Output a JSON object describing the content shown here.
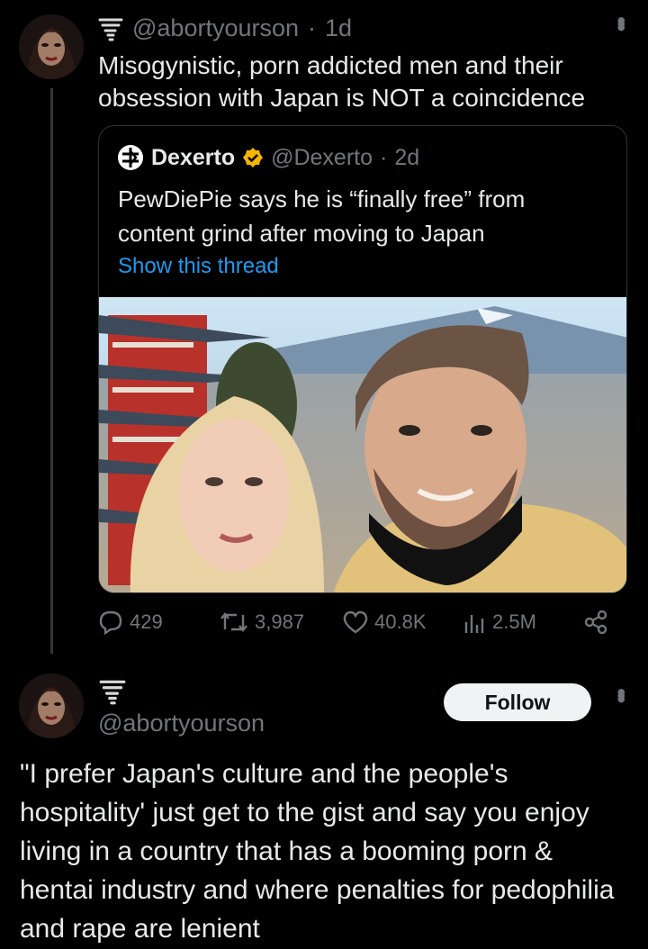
{
  "main_post": {
    "handle": "@abortyourson",
    "separator": "·",
    "time": "1d",
    "text": "Misogynistic, porn addicted men and their obsession with Japan is NOT a coincidence",
    "more_icon": "more-vertical-icon"
  },
  "quoted_post": {
    "name": "Dexerto",
    "handle": "@Dexerto",
    "separator": "·",
    "time": "2d",
    "verified_badge_color": "#f4b400",
    "text": "PewDiePie says he is “finally free” from content grind after moving to Japan",
    "link": "Show this thread",
    "image_alt": "Photo of a blonde woman and a bearded man smiling in front of a red pagoda with Mount Fuji and a city in the background"
  },
  "actions": {
    "replies": "429",
    "reposts": "3,987",
    "likes": "40.8K",
    "views": "2.5M"
  },
  "reply_post": {
    "handle": "@abortyourson",
    "follow_label": "Follow",
    "text": "\"I prefer Japan's culture and the people's hospitality' just get to the gist and say you enjoy living in a country that has a booming porn & hentai industry and where penalties for pedophilia and rape are lenient"
  },
  "colors": {
    "background": "#000000",
    "text": "#e7e9ea",
    "muted": "#71767b",
    "link": "#1d9bf0",
    "border": "#2f3336"
  }
}
